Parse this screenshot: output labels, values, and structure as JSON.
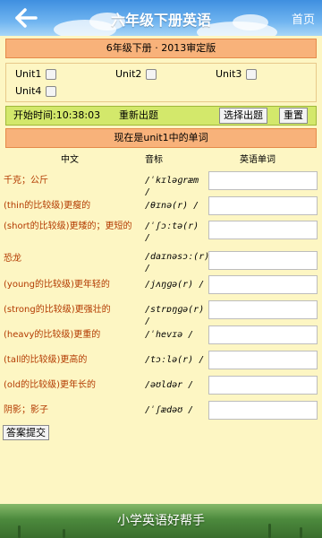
{
  "header": {
    "title": "六年级下册英语",
    "home_label": "首页"
  },
  "version_bar": "6年级下册 · 2013审定版",
  "units": [
    {
      "label": "Unit1",
      "checked": false
    },
    {
      "label": "Unit2",
      "checked": false
    },
    {
      "label": "Unit3",
      "checked": false
    },
    {
      "label": "Unit4",
      "checked": false
    }
  ],
  "controls": {
    "timer": "开始时间:10:38:03",
    "renew_label": "重新出题",
    "select_label": "选择出题",
    "reset_label": "重置"
  },
  "status": "现在是unit1中的单词",
  "columns": {
    "chinese": "中文",
    "phonetic": "音标",
    "english": "英语单词"
  },
  "words": [
    {
      "cn": "千克；公斤",
      "phonetic": "/ˈkɪləɡræm /"
    },
    {
      "cn": "(thin的比较级)更瘦的",
      "phonetic": "/θɪnə(r) /"
    },
    {
      "cn": "(short的比较级)更矮的；更短的",
      "phonetic": "/ˈʃɔːtə(r) /"
    },
    {
      "cn": "恐龙",
      "phonetic": "/daɪnəsɔː(r) /"
    },
    {
      "cn": "(young的比较级)更年轻的",
      "phonetic": "/jʌŋɡə(r) /"
    },
    {
      "cn": "(strong的比较级)更强壮的",
      "phonetic": "/strɒŋɡə(r) /"
    },
    {
      "cn": "(heavy的比较级)更重的",
      "phonetic": "/ˈhevɪə /"
    },
    {
      "cn": "(tall的比较级)更高的",
      "phonetic": "/tɔːlə(r) /"
    },
    {
      "cn": "(old的比较级)更年长的",
      "phonetic": "/əʊldər /"
    },
    {
      "cn": "阴影；影子",
      "phonetic": "/ˈʃædəʊ /"
    }
  ],
  "submit_label": "答案提交",
  "footer": {
    "slogan": "小学英语好帮手"
  }
}
